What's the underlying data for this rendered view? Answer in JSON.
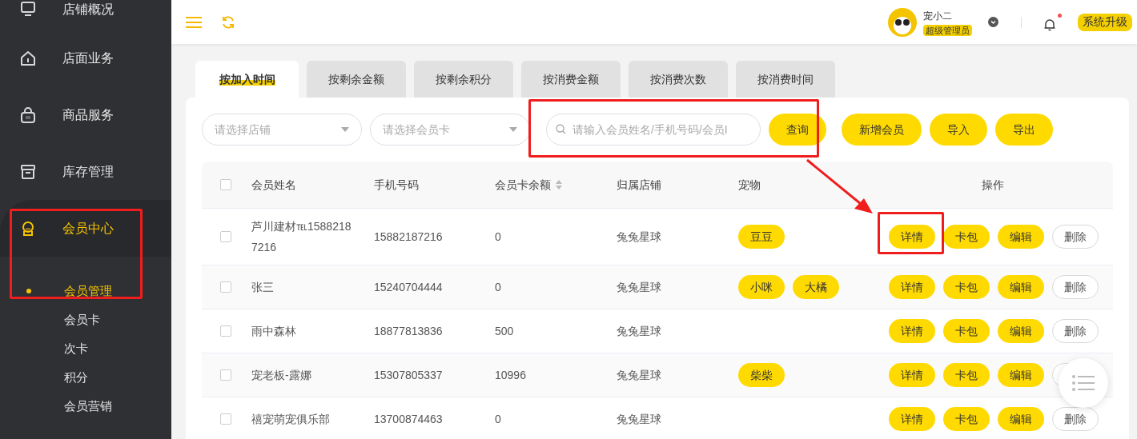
{
  "sidebar": {
    "items": [
      {
        "label": "店铺概况",
        "selected": false
      },
      {
        "label": "店面业务",
        "selected": false
      },
      {
        "label": "商品服务",
        "selected": false
      },
      {
        "label": "库存管理",
        "selected": false
      },
      {
        "label": "会员中心",
        "selected": true,
        "children": [
          {
            "label": "会员管理",
            "selected": true
          },
          {
            "label": "会员卡",
            "selected": false
          },
          {
            "label": "次卡",
            "selected": false
          },
          {
            "label": "积分",
            "selected": false
          },
          {
            "label": "会员营销",
            "selected": false
          }
        ]
      }
    ]
  },
  "header": {
    "user_name": "宠小二",
    "role": "超级管理员",
    "notification": true,
    "upgrade_button": "系统升级"
  },
  "tabs": [
    {
      "label": "按加入时间",
      "selected": true
    },
    {
      "label": "按剩余金额",
      "selected": false
    },
    {
      "label": "按剩余积分",
      "selected": false
    },
    {
      "label": "按消费金额",
      "selected": false
    },
    {
      "label": "按消费次数",
      "selected": false
    },
    {
      "label": "按消费时间",
      "selected": false
    }
  ],
  "filters": {
    "store_select": {
      "placeholder": "请选择店铺"
    },
    "card_select": {
      "placeholder": "请选择会员卡"
    },
    "search": {
      "placeholder": "请输入会员姓名/手机号码/会员I"
    }
  },
  "toolbar_buttons": [
    "查询",
    "新增会员",
    "导入",
    "导出"
  ],
  "table": {
    "select_all": {
      "checked": false
    },
    "columns": [
      {
        "label": "会员姓名",
        "kind": "plain"
      },
      {
        "label": "手机号码",
        "kind": "plain"
      },
      {
        "label": "会员卡余额",
        "kind": "sortable"
      },
      {
        "label": "归属店铺",
        "kind": "plain"
      },
      {
        "label": "宠物",
        "kind": "plain"
      },
      {
        "label": "操作",
        "kind": "plain"
      }
    ],
    "rows": [
      {
        "checked": false,
        "name": "芦川建材℡15882187216",
        "phone": "15882187216",
        "balance": "0",
        "store": "兔兔星球",
        "pets": [
          "豆豆"
        ],
        "actions": [
          {
            "kind": "primary",
            "label": "详情"
          },
          {
            "kind": "primary",
            "label": "卡包"
          },
          {
            "kind": "primary",
            "label": "编辑"
          },
          {
            "kind": "outline",
            "label": "删除"
          }
        ]
      },
      {
        "checked": false,
        "name": "张三",
        "phone": "15240704444",
        "balance": "0",
        "store": "兔兔星球",
        "pets": [
          "小咪",
          "大橘"
        ],
        "actions": [
          {
            "kind": "primary",
            "label": "详情"
          },
          {
            "kind": "primary",
            "label": "卡包"
          },
          {
            "kind": "primary",
            "label": "编辑"
          },
          {
            "kind": "outline",
            "label": "删除"
          }
        ]
      },
      {
        "checked": false,
        "name": "雨中森林",
        "phone": "18877813836",
        "balance": "500",
        "store": "兔兔星球",
        "actions": [
          {
            "kind": "primary",
            "label": "详情"
          },
          {
            "kind": "primary",
            "label": "卡包"
          },
          {
            "kind": "primary",
            "label": "编辑"
          },
          {
            "kind": "outline",
            "label": "删除"
          }
        ]
      },
      {
        "checked": false,
        "name": "宠老板-露娜",
        "phone": "15307805337",
        "balance": "10996",
        "store": "兔兔星球",
        "pets": [
          "柴柴"
        ],
        "actions": [
          {
            "kind": "primary",
            "label": "详情"
          },
          {
            "kind": "primary",
            "label": "卡包"
          },
          {
            "kind": "primary",
            "label": "编辑"
          },
          {
            "kind": "outline"
          }
        ]
      },
      {
        "checked": false,
        "name": "禧宠萌宠俱乐部",
        "phone": "13700874463",
        "balance": "0",
        "store": "兔兔星球",
        "actions": [
          {
            "kind": "primary",
            "label": "详情"
          },
          {
            "kind": "primary",
            "label": "卡包"
          },
          {
            "kind": "primary",
            "label": "编辑"
          },
          {
            "kind": "outline",
            "label": "删除"
          }
        ]
      }
    ]
  }
}
